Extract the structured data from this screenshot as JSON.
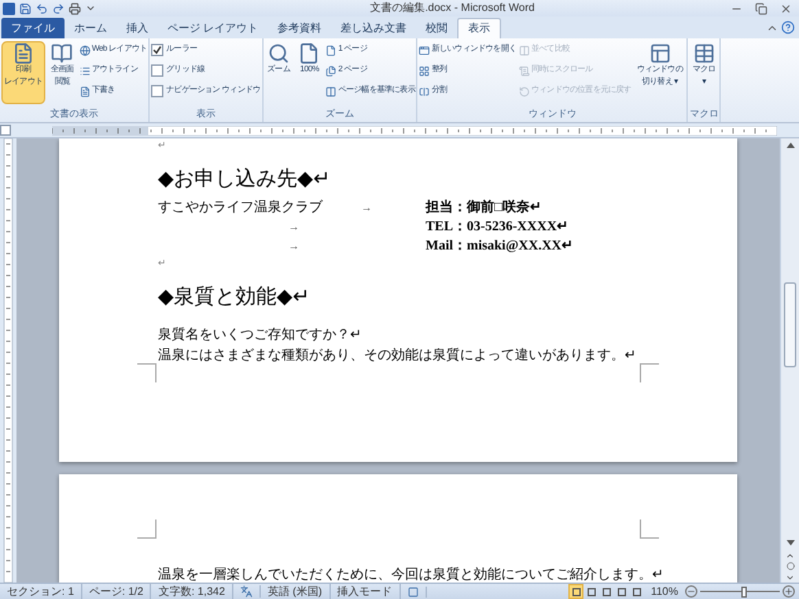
{
  "window": {
    "title": "文書の編集.docx - Microsoft Word"
  },
  "tabs": [
    {
      "label": "ファイル",
      "kind": "file",
      "selected": false
    },
    {
      "label": "ホーム",
      "kind": "tab",
      "selected": false
    },
    {
      "label": "挿入",
      "kind": "tab",
      "selected": false
    },
    {
      "label": "ページ レイアウト",
      "kind": "tab",
      "selected": false
    },
    {
      "label": "参考資料",
      "kind": "tab",
      "selected": false
    },
    {
      "label": "差し込み文書",
      "kind": "tab",
      "selected": false
    },
    {
      "label": "校閲",
      "kind": "tab",
      "selected": false
    },
    {
      "label": "表示",
      "kind": "tab",
      "selected": true
    }
  ],
  "ribbon": [
    {
      "label": "文書の表示",
      "columns": [
        [
          {
            "kind": "large",
            "label_lines": [
              "印刷",
              "レイアウト"
            ],
            "selected": true
          }
        ],
        [
          {
            "kind": "large",
            "label_lines": [
              "全画面",
              "閲覧"
            ],
            "selected": false
          }
        ],
        [
          {
            "kind": "small",
            "label": "Web レイアウト"
          },
          {
            "kind": "small",
            "label": "アウトライン"
          },
          {
            "kind": "small",
            "label": "下書き"
          }
        ]
      ]
    },
    {
      "label": "表示",
      "columns": [
        [
          {
            "kind": "check",
            "label": "ルーラー",
            "checked": true
          },
          {
            "kind": "check",
            "label": "グリッド線",
            "checked": false
          },
          {
            "kind": "check",
            "label": "ナビゲーション ウィンドウ",
            "checked": false
          }
        ]
      ]
    },
    {
      "label": "ズーム",
      "columns": [
        [
          {
            "kind": "large",
            "label_lines": [
              "ズーム"
            ]
          }
        ],
        [
          {
            "kind": "large",
            "label_lines": [
              "100%"
            ]
          }
        ],
        [
          {
            "kind": "small",
            "label": "1 ページ"
          },
          {
            "kind": "small",
            "label": "2 ページ"
          },
          {
            "kind": "small",
            "label": "ページ幅を基準に表示"
          }
        ]
      ]
    },
    {
      "label": "ウィンドウ",
      "columns": [
        [
          {
            "kind": "small",
            "label": "新しいウィンドウを開く",
            "disabled": false
          },
          {
            "kind": "small",
            "label": "整列",
            "disabled": false
          },
          {
            "kind": "small",
            "label": "分割",
            "disabled": false
          }
        ],
        [
          {
            "kind": "small",
            "label": "並べて比較",
            "disabled": true
          },
          {
            "kind": "small",
            "label": "同時にスクロール",
            "disabled": true
          },
          {
            "kind": "small",
            "label": "ウィンドウの位置を元に戻す",
            "disabled": true
          }
        ],
        [
          {
            "kind": "large",
            "label_lines": [
              "ウィンドウの",
              "切り替え ▾"
            ]
          }
        ]
      ]
    },
    {
      "label": "マクロ",
      "columns": [
        [
          {
            "kind": "large",
            "label_lines": [
              "マクロ",
              "▾"
            ]
          }
        ]
      ]
    }
  ],
  "pages": [
    {
      "lines": [
        {
          "kind": "mark",
          "text": "↵"
        },
        {
          "kind": "heading",
          "text": "◆お申し込み先◆↵"
        },
        {
          "kind": "tabbed",
          "col_1": "すこやかライフ温泉クラブ",
          "tab": "→",
          "col_2": "担当：御前□咲奈↵"
        },
        {
          "kind": "tabbed",
          "tab": "→",
          "col_2": "TEL：03-5236-XXXX↵"
        },
        {
          "kind": "tabbed",
          "tab": "→",
          "col_2": "Mail：misaki@XX.XX↵"
        },
        {
          "kind": "mark",
          "text": "↵"
        },
        {
          "kind": "heading",
          "text": "◆泉質と効能◆↵"
        },
        {
          "kind": "body",
          "text": "泉質名をいくつご存知ですか？↵"
        },
        {
          "kind": "body",
          "text": "温泉にはさまざまな種類があり、その効能は泉質によって違いがあります。↵"
        }
      ]
    },
    {
      "lines": [
        {
          "kind": "body",
          "text": "温泉を一層楽しんでいただくために、今回は泉質と効能についてご紹介します。↵"
        }
      ]
    }
  ],
  "status_bar": {
    "items": [
      {
        "kind": "text",
        "text": "セクション: 1"
      },
      {
        "kind": "text",
        "text": "ページ: 1/2"
      },
      {
        "kind": "text",
        "text": "文字数: 1,342"
      },
      {
        "kind": "icon"
      },
      {
        "kind": "text",
        "text": "英語 (米国)"
      },
      {
        "kind": "text",
        "text": "挿入モード"
      },
      {
        "kind": "icon"
      }
    ],
    "view_buttons": [
      {
        "selected": true
      },
      {
        "selected": false
      },
      {
        "selected": false
      },
      {
        "selected": false
      },
      {
        "selected": false
      }
    ],
    "zoom": "110%",
    "zoom_level": {
      "level": 0.55
    }
  }
}
